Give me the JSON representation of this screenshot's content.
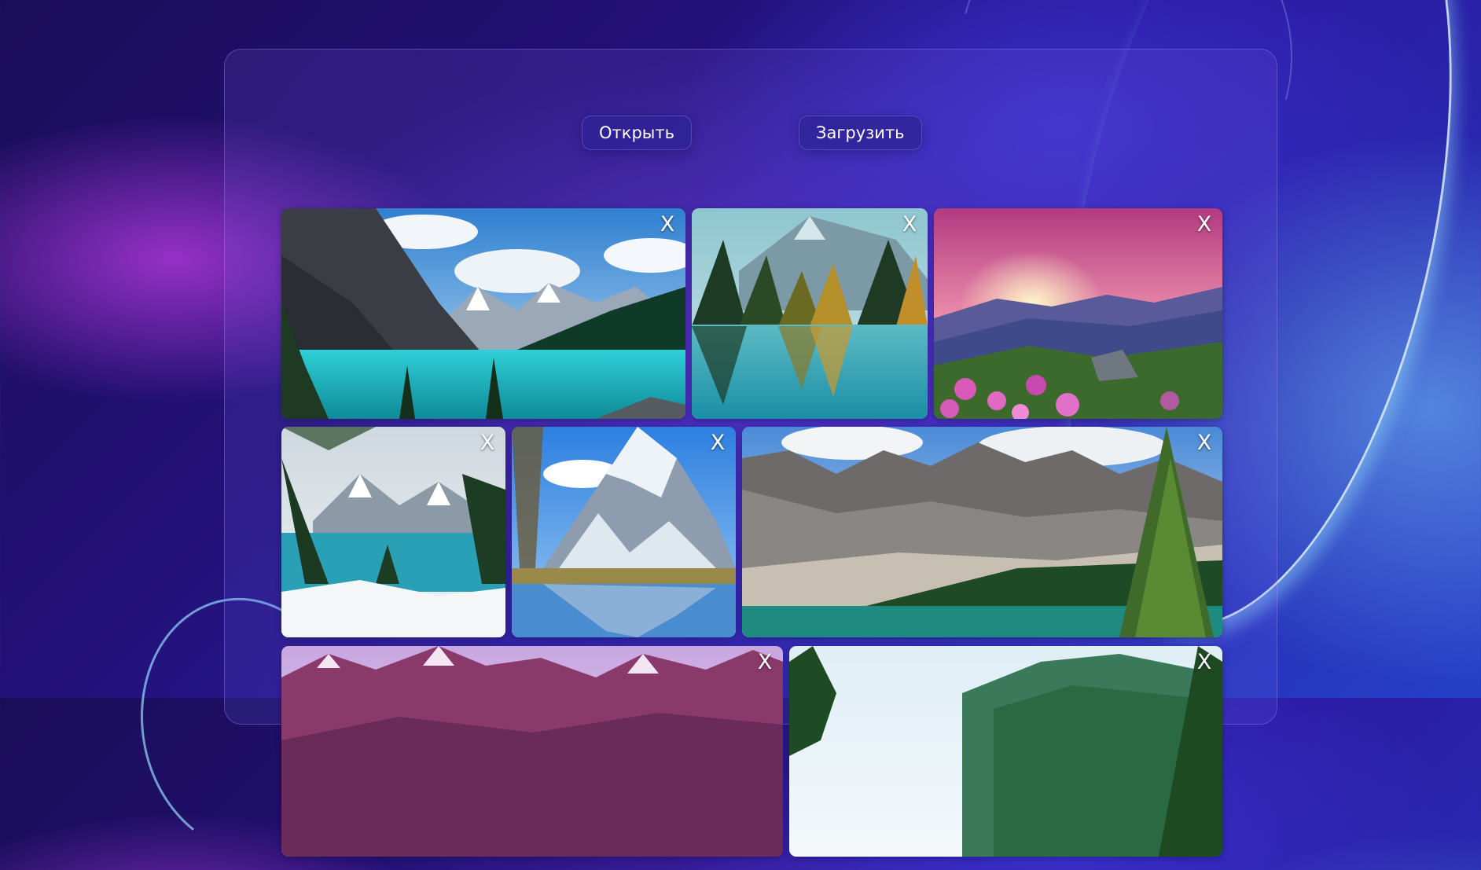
{
  "toolbar": {
    "open_label": "Открыть",
    "upload_label": "Загрузить"
  },
  "gallery": {
    "close_label": "X",
    "images": [
      {
        "name": "image-lake-turquoise-mountains"
      },
      {
        "name": "image-forest-lake-reflection"
      },
      {
        "name": "image-sunset-flowers-hills"
      },
      {
        "name": "image-winter-lake-pines"
      },
      {
        "name": "image-snowy-peak-reflection"
      },
      {
        "name": "image-rocky-ridge-lake"
      },
      {
        "name": "image-purple-mountains"
      },
      {
        "name": "image-green-valley"
      }
    ]
  }
}
